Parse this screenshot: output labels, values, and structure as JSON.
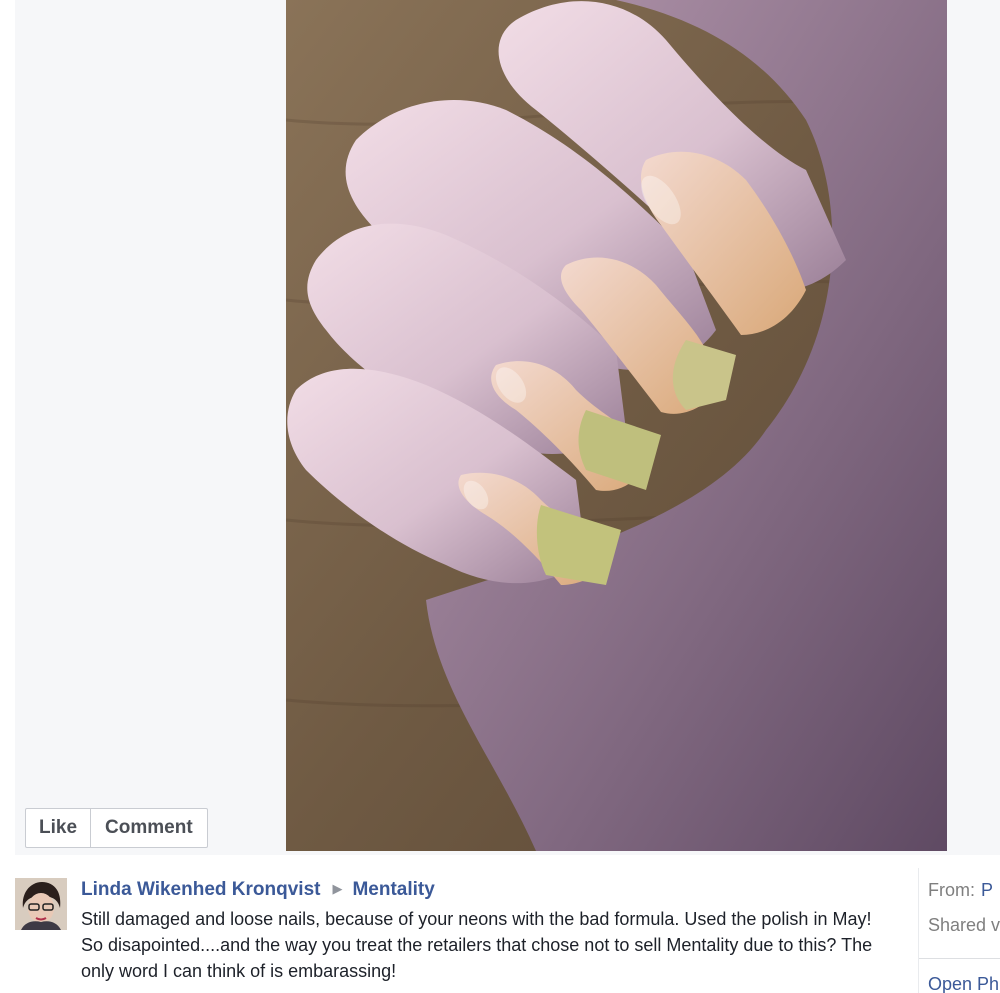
{
  "actions": {
    "like_label": "Like",
    "comment_label": "Comment"
  },
  "post": {
    "author": "Linda Wikenhed Kronqvist",
    "separator_icon": "triangle-right-icon",
    "target_page": "Mentality",
    "text": "Still damaged and loose nails, because of your neons with the bad formula. Used the polish in May! So disapointed....and the way you treat the retailers that chose not to sell Mentality due to this? The only word I can think of is embarassing!"
  },
  "side": {
    "from_label": "From:",
    "from_value": "P",
    "shared_label": "Shared v",
    "open_label": "Open Ph"
  },
  "colors": {
    "link": "#3b5998",
    "text": "#1d2129",
    "muted": "#7f7f7f",
    "stage_bg": "#f6f7f9"
  }
}
